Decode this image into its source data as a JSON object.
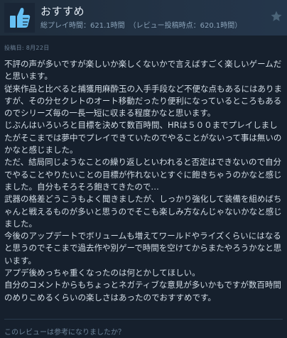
{
  "review": {
    "recommendation": "おすすめ",
    "hours_total": "総プレイ時間：621.1時間",
    "hours_at_review": "（レビュー投稿時点：620.1時間）",
    "posted": "投稿日: 8月22日",
    "paragraphs": [
      "不評の声が多いですが楽しいか楽しくないかで言えばすごく楽しいゲームだと思います。",
      "従来作品と比べると捕獲用麻酔玉の入手手段など不便な点もあるにはありますが、その分セクレトのオート移動だったり便利になっているところもあるのでシリーズ毎の一長一短に収まる程度かなと思います。",
      "じぶんはいろいろと目標を決めて数百時間、HRは５００までプレイしましたがそこまでは夢中でプレイできていたのでやることがないって事は無いのかなと感じました。",
      "ただ、結局同じようなことの繰り返しといわれると否定はできないので自分でやることやりたいことの目標が作れないとすぐに飽きちゃうのかなと感じました。自分もそろそろ飽きてきたので…",
      "武器の格差どうこうもよく聞きましたが、しっかり強化して装備を組めばちゃんと戦えるものが多いと思うのでそこも楽しみ方なんじゃないかなと感じました。",
      "今後のアップデートでボリュームも増えてワールドやライズくらいにはなると思うのでそこまで過去作や別ゲーで時間を空けてからまたやろうかなと思います。",
      "アプデ後めっちゃ重くなったのは何とかしてほしい。",
      "自分のコメントからもちょっとネガティブな意見が多いかもですが数百時間のめりこめるくらいの楽しさはあったのでおすすめです。"
    ],
    "helpful_prompt": "このレビューは参考になりましたか？"
  },
  "icons": {
    "thumb": "thumbs-up-icon",
    "award": "star-icon"
  },
  "colors": {
    "thumb_blue": "#66c0f4",
    "text": "#d3dde6",
    "muted": "#8aa2b8"
  }
}
